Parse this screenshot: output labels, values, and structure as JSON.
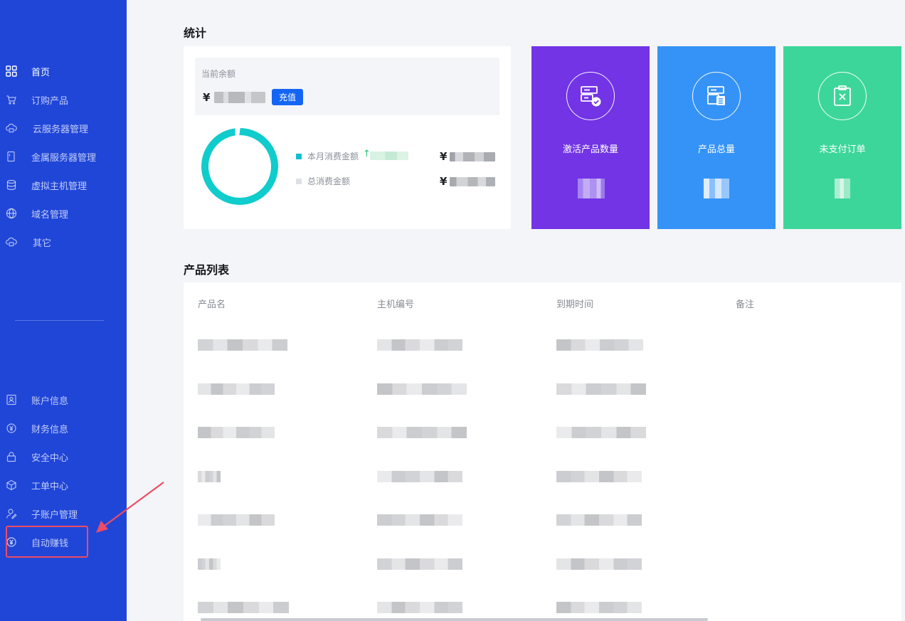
{
  "sidebar": {
    "nav": [
      {
        "label": "首页",
        "icon": "grid-icon",
        "active": true
      },
      {
        "label": "订购产品",
        "icon": "cart-icon",
        "active": false
      },
      {
        "label": "云服务器管理",
        "icon": "cloud-server-icon",
        "active": false
      },
      {
        "label": "金属服务器管理",
        "icon": "metal-server-icon",
        "active": false
      },
      {
        "label": "虚拟主机管理",
        "icon": "database-icon",
        "active": false
      },
      {
        "label": "域名管理",
        "icon": "globe-icon",
        "active": false
      },
      {
        "label": "其它",
        "icon": "cloud-other-icon",
        "active": false
      }
    ],
    "account_nav": [
      {
        "label": "账户信息",
        "icon": "user-card-icon"
      },
      {
        "label": "财务信息",
        "icon": "yuan-circle-icon"
      },
      {
        "label": "安全中心",
        "icon": "lock-icon"
      },
      {
        "label": "工单中心",
        "icon": "cube-icon"
      },
      {
        "label": "子账户管理",
        "icon": "sub-user-icon"
      },
      {
        "label": "自动赚钱",
        "icon": "yuan-coin-icon"
      }
    ]
  },
  "stats": {
    "title": "统计",
    "balance": {
      "label": "当前余额",
      "currency": "¥",
      "recharge_label": "充值"
    },
    "donut": {
      "monthly_label": "本月消费金额",
      "total_label": "总消费金额",
      "currency": "¥",
      "ring_color": "#10cccc",
      "monthly_color": "#10c0cc",
      "total_color": "#dde0e6"
    },
    "cards": [
      {
        "label": "激活产品数量",
        "color": "#7234e4",
        "icon": "server-check-icon"
      },
      {
        "label": "产品总量",
        "color": "#3593f7",
        "icon": "server-list-icon"
      },
      {
        "label": "未支付订单",
        "color": "#3dd69a",
        "icon": "clipboard-x-icon"
      }
    ]
  },
  "products": {
    "title": "产品列表",
    "columns": [
      "产品名",
      "主机编号",
      "到期时间",
      "备注"
    ]
  }
}
